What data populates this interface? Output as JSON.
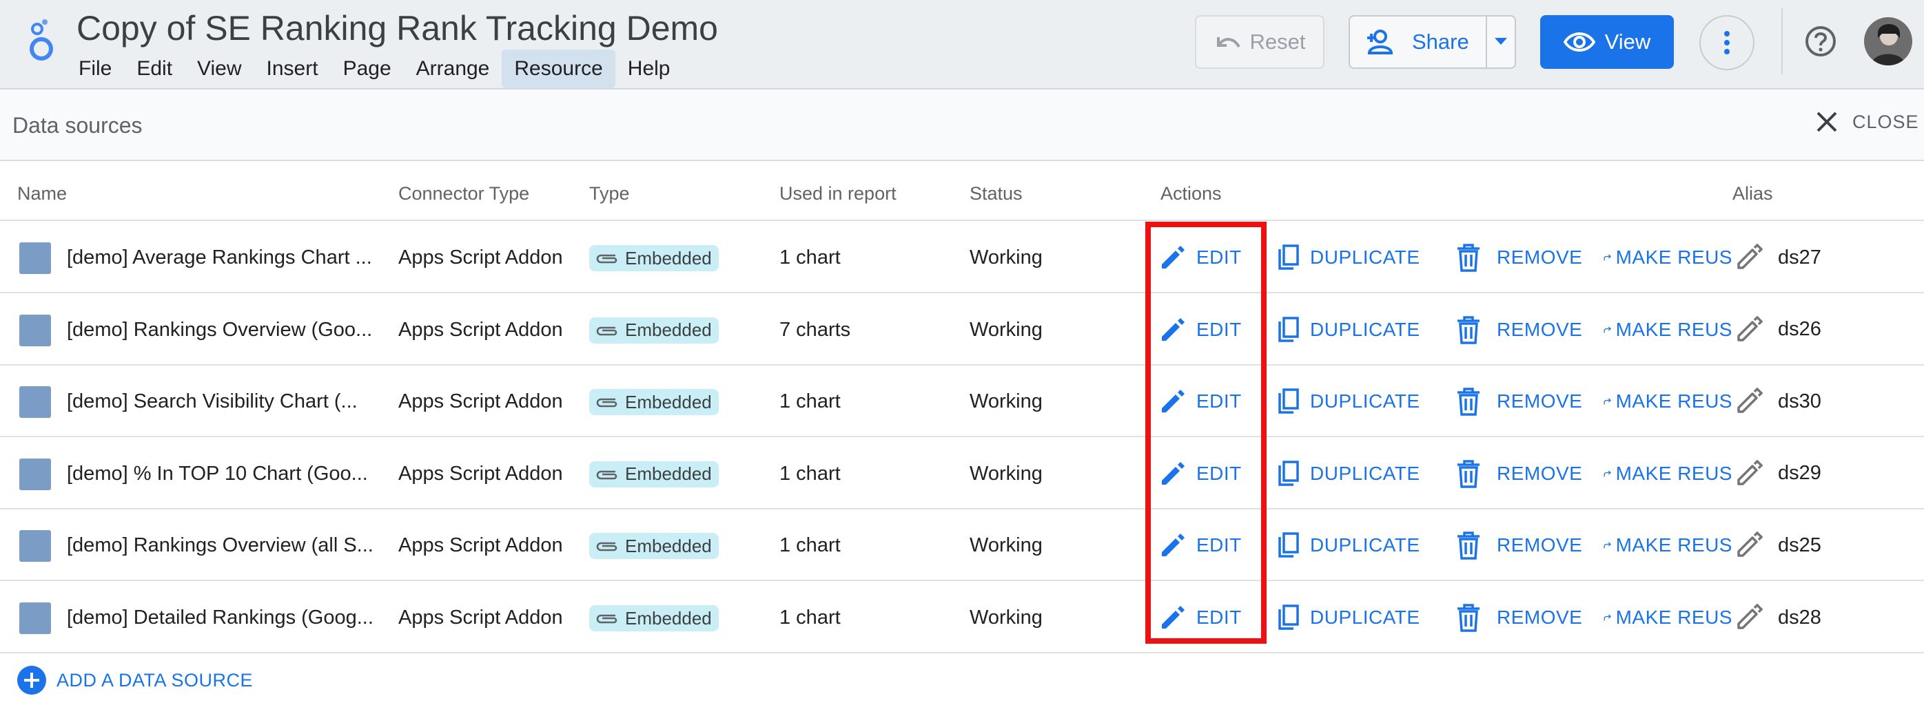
{
  "app": {
    "title": "Copy of SE Ranking Rank Tracking Demo",
    "menu": [
      {
        "label": "File",
        "name": "menu-file"
      },
      {
        "label": "Edit",
        "name": "menu-edit"
      },
      {
        "label": "View",
        "name": "menu-view"
      },
      {
        "label": "Insert",
        "name": "menu-insert"
      },
      {
        "label": "Page",
        "name": "menu-page"
      },
      {
        "label": "Arrange",
        "name": "menu-arrange"
      },
      {
        "label": "Resource",
        "name": "menu-resource",
        "active": true
      },
      {
        "label": "Help",
        "name": "menu-help"
      }
    ]
  },
  "toolbar": {
    "reset_label": "Reset",
    "share_label": "Share",
    "view_label": "View"
  },
  "panel": {
    "title": "Data sources",
    "close_label": "CLOSE"
  },
  "table": {
    "headers": {
      "name": "Name",
      "connector": "Connector Type",
      "type": "Type",
      "used": "Used in report",
      "status": "Status",
      "actions": "Actions",
      "alias": "Alias"
    },
    "action_labels": {
      "edit": "EDIT",
      "duplicate": "DUPLICATE",
      "remove": "REMOVE",
      "make_reusable": "MAKE REUS"
    },
    "rows": [
      {
        "name": "[demo] Average Rankings Chart ...",
        "connector": "Apps Script Addon",
        "type": "Embedded",
        "used": "1 chart",
        "status": "Working",
        "alias": "ds27"
      },
      {
        "name": "[demo] Rankings Overview (Goo...",
        "connector": "Apps Script Addon",
        "type": "Embedded",
        "used": "7 charts",
        "status": "Working",
        "alias": "ds26"
      },
      {
        "name": "[demo] Search Visibility Chart (...",
        "connector": "Apps Script Addon",
        "type": "Embedded",
        "used": "1 chart",
        "status": "Working",
        "alias": "ds30"
      },
      {
        "name": "[demo] % In TOP 10 Chart (Goo...",
        "connector": "Apps Script Addon",
        "type": "Embedded",
        "used": "1 chart",
        "status": "Working",
        "alias": "ds29"
      },
      {
        "name": "[demo] Rankings Overview (all S...",
        "connector": "Apps Script Addon",
        "type": "Embedded",
        "used": "1 chart",
        "status": "Working",
        "alias": "ds25"
      },
      {
        "name": "[demo] Detailed Rankings (Goog...",
        "connector": "Apps Script Addon",
        "type": "Embedded",
        "used": "1 chart",
        "status": "Working",
        "alias": "ds28"
      }
    ]
  },
  "footer": {
    "add_label": "ADD A DATA SOURCE"
  },
  "colors": {
    "accent": "#1a73e8",
    "highlight": "#ee1111",
    "chip": "#c9eef5",
    "source_square": "#7b9cc4"
  }
}
